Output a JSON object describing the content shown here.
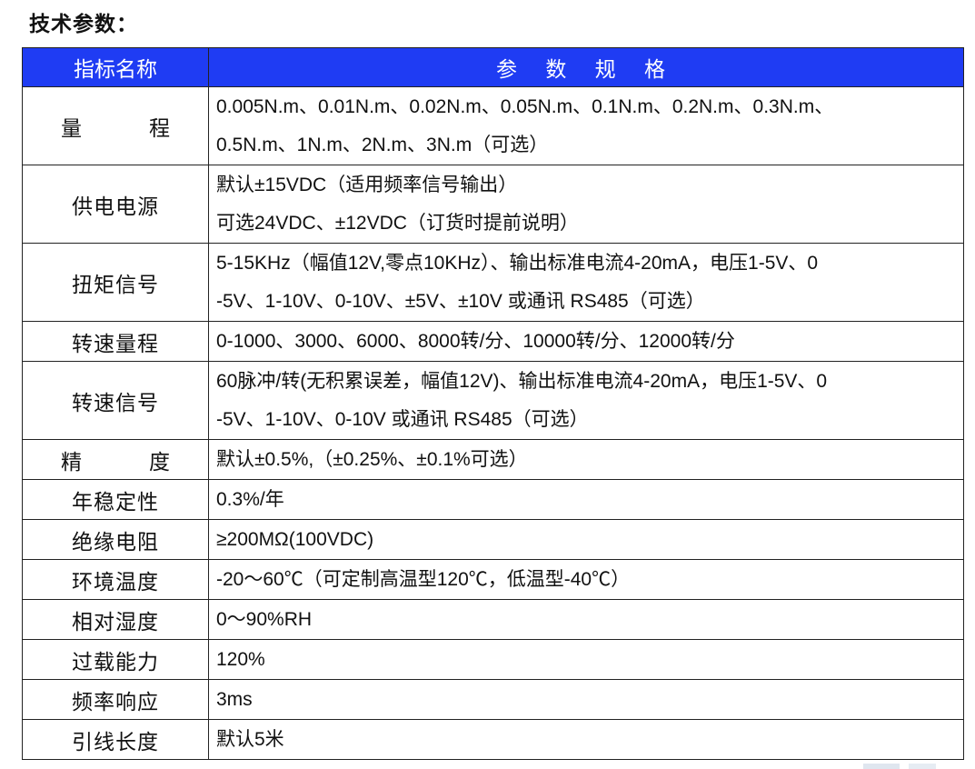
{
  "doc": {
    "title": "技术参数："
  },
  "table": {
    "header": {
      "name": "指标名称",
      "spec": "参 数 规 格"
    },
    "rows": [
      {
        "name": "量程",
        "lines": [
          "0.005N.m、0.01N.m、0.02N.m、0.05N.m、0.1N.m、0.2N.m、0.3N.m、",
          "0.5N.m、1N.m、2N.m、3N.m（可选）"
        ]
      },
      {
        "name": "供电电源",
        "lines": [
          "默认±15VDC（适用频率信号输出）",
          "可选24VDC、±12VDC（订货时提前说明）"
        ]
      },
      {
        "name": "扭矩信号",
        "lines": [
          "5-15KHz（幅值12V,零点10KHz）、输出标准电流4-20mA，电压1-5V、0",
          "-5V、1-10V、0-10V、±5V、±10V 或通讯 RS485（可选）"
        ]
      },
      {
        "name": "转速量程",
        "lines": [
          "0-1000、3000、6000、8000转/分、10000转/分、12000转/分"
        ]
      },
      {
        "name": "转速信号",
        "lines": [
          "60脉冲/转(无积累误差，幅值12V)、输出标准电流4-20mA，电压1-5V、0",
          "-5V、1-10V、0-10V 或通讯 RS485（可选）"
        ]
      },
      {
        "name": "精度",
        "lines": [
          "默认±0.5%,（±0.25%、±0.1%可选）"
        ]
      },
      {
        "name": "年稳定性",
        "lines": [
          "0.3%/年"
        ]
      },
      {
        "name": "绝缘电阻",
        "lines": [
          "≥200MΩ(100VDC)"
        ]
      },
      {
        "name": "环境温度",
        "lines": [
          "-20～60℃（可定制高温型120℃，低温型-40℃）"
        ]
      },
      {
        "name": "相对湿度",
        "lines": [
          "0～90%RH"
        ]
      },
      {
        "name": "过载能力",
        "lines": [
          "120%"
        ]
      },
      {
        "name": "频率响应",
        "lines": [
          "3ms"
        ]
      },
      {
        "name": "引线长度",
        "lines": [
          "默认5米"
        ]
      }
    ]
  },
  "colors": {
    "header_bg": "#1f3cf3",
    "header_text": "#ffffff",
    "border": "#222222"
  }
}
